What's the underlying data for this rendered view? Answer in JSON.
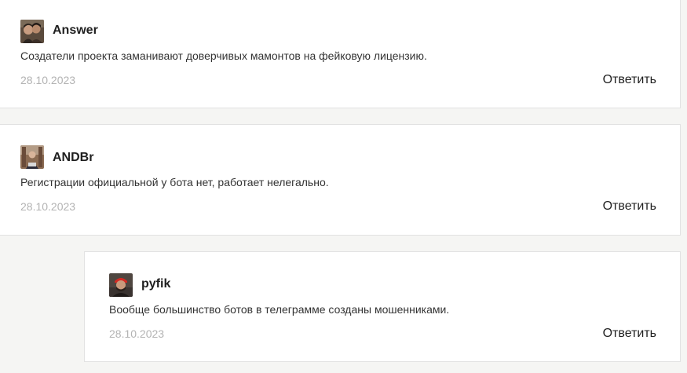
{
  "comments": [
    {
      "author": "Answer",
      "text": "Создатели проекта заманивают доверчивых мамонтов на фейковую лицензию.",
      "date": "28.10.2023",
      "reply_label": "Ответить",
      "avatar_icon": "user-avatar-photo"
    },
    {
      "author": "ANDBr",
      "text": "Регистрации официальной у бота нет, работает нелегально.",
      "date": "28.10.2023",
      "reply_label": "Ответить",
      "avatar_icon": "user-avatar-photo"
    },
    {
      "author": "pyfik",
      "text": "Вообще большинство ботов в телеграмме созданы мошенниками.",
      "date": "28.10.2023",
      "reply_label": "Ответить",
      "avatar_icon": "user-avatar-photo",
      "is_reply": true
    }
  ],
  "colors": {
    "page_background": "#f5f5f3",
    "card_background": "#ffffff",
    "card_border": "#e2e2e2",
    "date_text": "#b3b3b3",
    "body_text": "#333333"
  }
}
